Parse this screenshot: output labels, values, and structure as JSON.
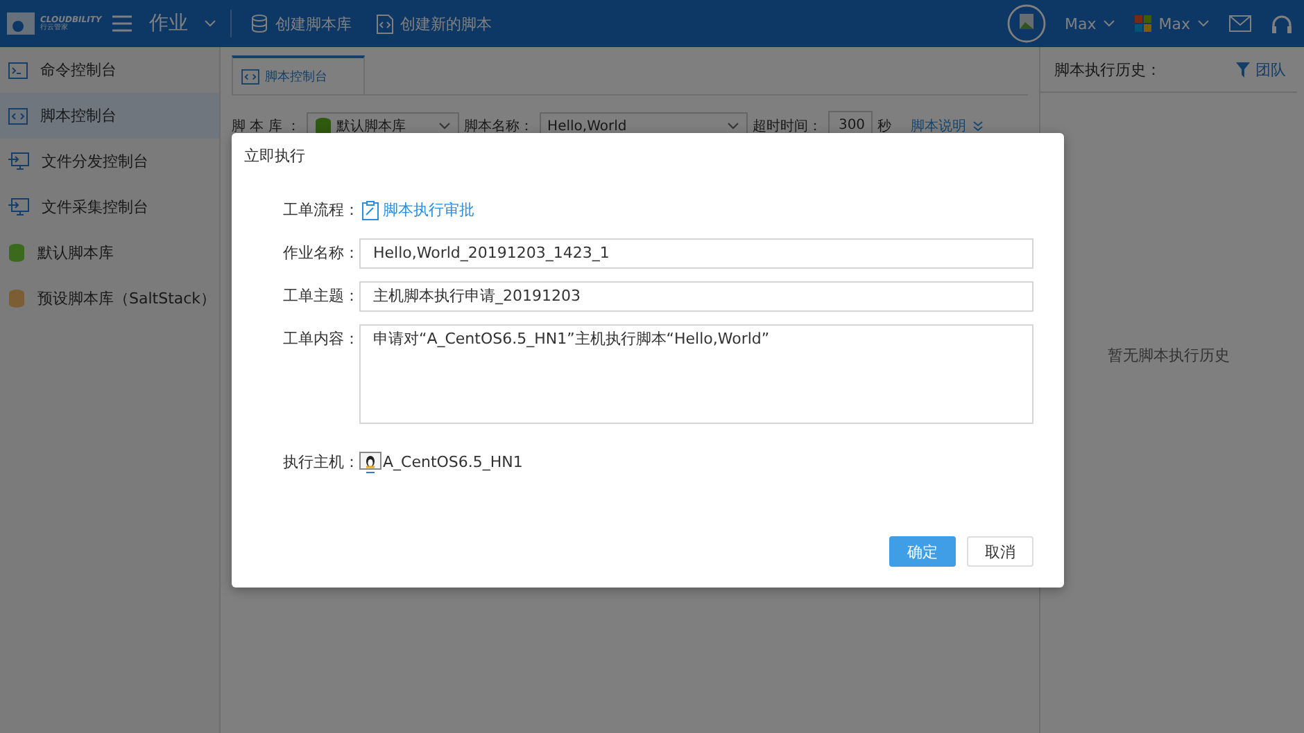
{
  "header": {
    "brand": "CLOUDBILITY",
    "brand_sub": "行云管家",
    "module": "作业",
    "actions": [
      {
        "label": "创建脚本库",
        "kind": "database"
      },
      {
        "label": "创建新的脚本",
        "kind": "script"
      }
    ],
    "user": "Max",
    "account": "Max"
  },
  "sidebar": {
    "items": [
      {
        "label": "命令控制台",
        "kind": "terminal",
        "selected": false
      },
      {
        "label": "脚本控制台",
        "kind": "code",
        "selected": true
      },
      {
        "label": "文件分发控制台",
        "kind": "monitor-in",
        "selected": false
      },
      {
        "label": "文件采集控制台",
        "kind": "monitor-out",
        "selected": false
      },
      {
        "label": "默认脚本库",
        "kind": "db",
        "color": "#3b6a1c",
        "selected": false
      },
      {
        "label": "预设脚本库（SaltStack）",
        "kind": "db",
        "color": "#7d5e34",
        "selected": false
      }
    ]
  },
  "main": {
    "tabs": [
      {
        "label": "脚本控制台",
        "selected": true
      }
    ],
    "filters": {
      "library_label": "脚 本 库 ：",
      "library_value": "默认脚本库",
      "name_label": "脚本名称：",
      "name_value": "Hello,World",
      "timeout_label": "超时时间：",
      "timeout_value": "300",
      "timeout_unit": "秒",
      "doc_link": "脚本说明"
    }
  },
  "history": {
    "title": "脚本执行历史：",
    "filter": "团队",
    "empty": "暂无脚本执行历史"
  },
  "dialog": {
    "title": "立即执行",
    "fields": [
      {
        "label": "工单流程：",
        "kind": "link",
        "value": "脚本执行审批"
      },
      {
        "label": "作业名称：",
        "kind": "input",
        "value": "Hello,World_20191203_1423_1"
      },
      {
        "label": "工单主题：",
        "kind": "input",
        "value": "主机脚本执行申请_20191203"
      },
      {
        "label": "工单内容：",
        "kind": "textarea",
        "value": "申请对“A_CentOS6.5_HN1”主机执行脚本“Hello,World”"
      },
      {
        "label": "执行主机：",
        "kind": "host",
        "value": "A_CentOS6.5_HN1"
      }
    ],
    "buttons": [
      {
        "label": "确定",
        "primary": true
      },
      {
        "label": "取消",
        "primary": false
      }
    ]
  }
}
